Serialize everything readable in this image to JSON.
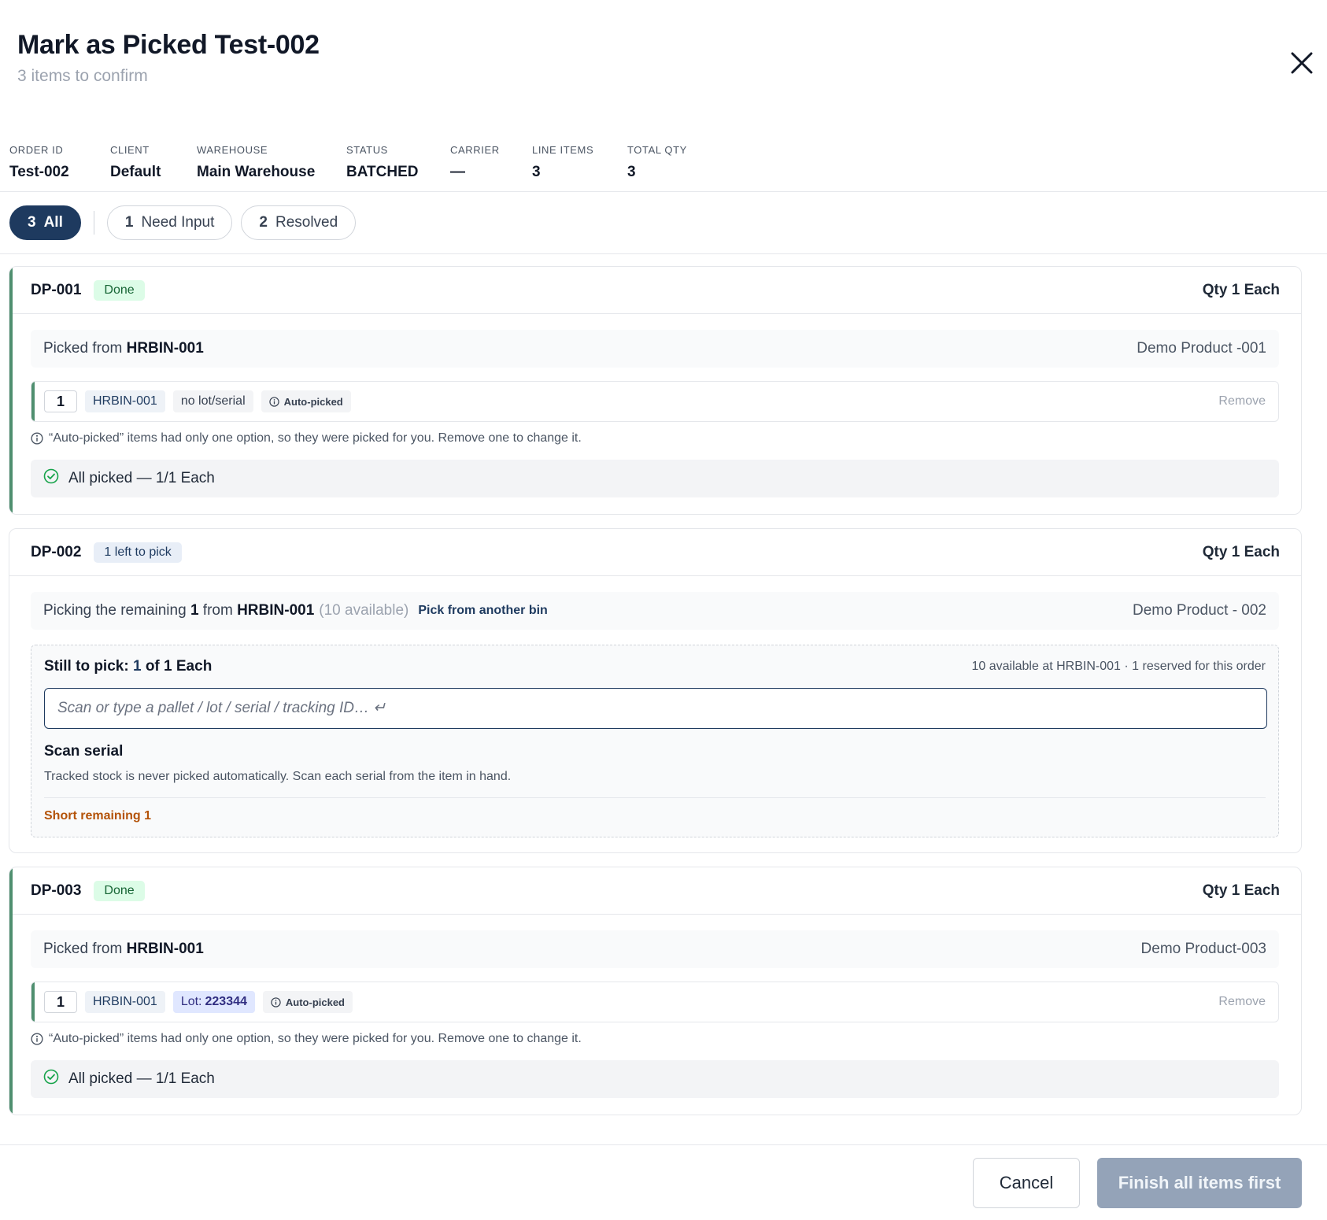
{
  "dialog": {
    "title": "Mark as Picked Test-002",
    "subtitle": "3 items to confirm",
    "close_icon": "close-icon"
  },
  "meta": [
    {
      "label": "ORDER ID",
      "value": "Test-002"
    },
    {
      "label": "CLIENT",
      "value": "Default"
    },
    {
      "label": "WAREHOUSE",
      "value": "Main Warehouse"
    },
    {
      "label": "STATUS",
      "value": "BATCHED"
    },
    {
      "label": "CARRIER",
      "value": "—"
    },
    {
      "label": "LINE ITEMS",
      "value": "3"
    },
    {
      "label": "TOTAL QTY",
      "value": "3"
    }
  ],
  "tabs": [
    {
      "count": "3",
      "label": "All",
      "active": true
    },
    {
      "count": "1",
      "label": "Need Input"
    },
    {
      "count": "2",
      "label": "Resolved"
    }
  ],
  "items": [
    {
      "sku": "DP-001",
      "badge": "Done",
      "qty": "Qty 1 Each",
      "picked_from_prefix": "Picked from",
      "bin": "HRBIN-001",
      "product": "Demo Product -001",
      "line": {
        "qty": "1",
        "bin": "HRBIN-001",
        "lot": "no lot/serial",
        "auto": "Auto-picked",
        "remove": "Remove"
      },
      "note": "“Auto-picked” items had only one option, so they were picked for you. Remove one to change it.",
      "all_picked": "All picked — 1/1 Each"
    },
    {
      "sku": "DP-002",
      "badge": "1 left to pick",
      "qty": "Qty 1 Each",
      "picking_prefix": "Picking the remaining",
      "picking_count": "1",
      "picking_from": "from",
      "bin": "HRBIN-001",
      "available": "(10 available)",
      "pick_other": "Pick from another bin",
      "product": "Demo Product - 002",
      "still_label": "Still to pick:",
      "still_count": "1",
      "still_suffix": "of 1 Each",
      "still_meta": "10 available at HRBIN-001 · 1 reserved for this order",
      "scan_placeholder": "Scan or type a pallet / lot / serial / tracking ID… ↵",
      "scan_title": "Scan serial",
      "scan_desc": "Tracked stock is never picked automatically. Scan each serial from the item in hand.",
      "short": "Short remaining 1"
    },
    {
      "sku": "DP-003",
      "badge": "Done",
      "qty": "Qty 1 Each",
      "picked_from_prefix": "Picked from",
      "bin": "HRBIN-001",
      "product": "Demo Product-003",
      "line": {
        "qty": "1",
        "bin": "HRBIN-001",
        "lot_label": "Lot:",
        "lot_num": "223344",
        "auto": "Auto-picked",
        "remove": "Remove"
      },
      "note": "“Auto-picked” items had only one option, so they were picked for you. Remove one to change it.",
      "all_picked": "All picked — 1/1 Each"
    }
  ],
  "footer": {
    "cancel": "Cancel",
    "finish": "Finish all items first"
  },
  "colors": {
    "primary": "#1e3a5f",
    "done_accent": "#4f8f6f",
    "warning": "#b45309",
    "disabled": "#94a3b8"
  }
}
